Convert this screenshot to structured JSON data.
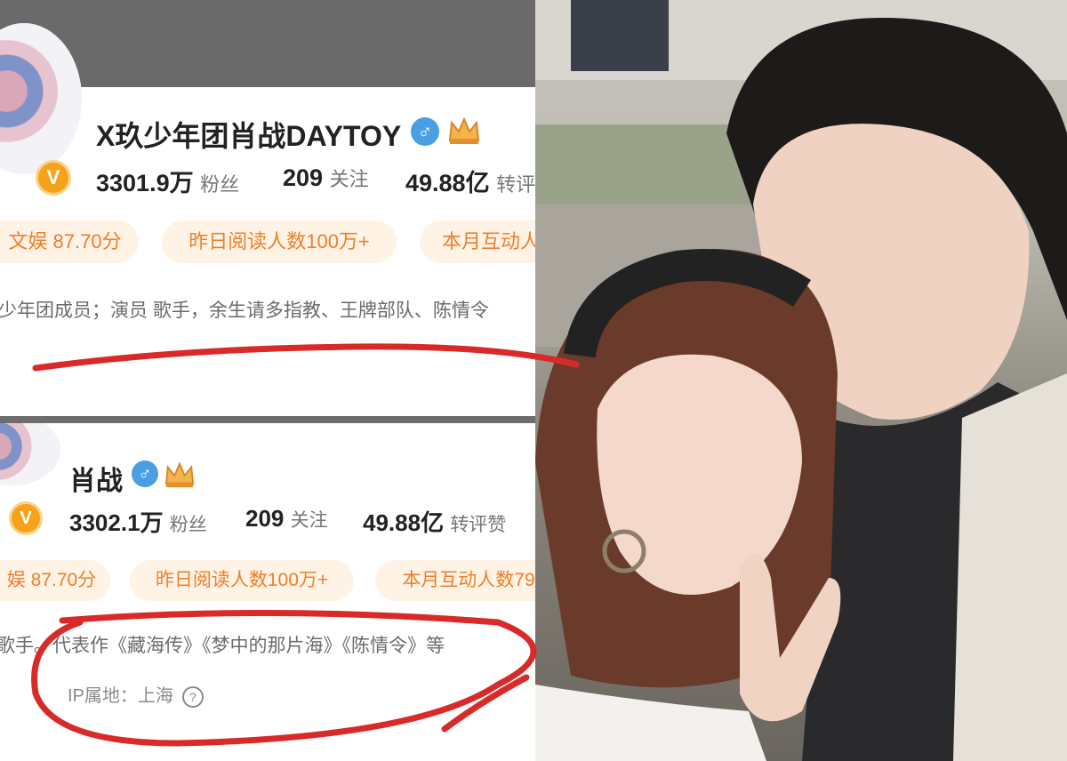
{
  "profile_a": {
    "name": "X玖少年团肖战DAYTOY",
    "gender_symbol": "♂",
    "crown_icon": "crown-icon",
    "verified_badge": "V",
    "followers_value": "3301.9万",
    "followers_label": "粉丝",
    "following_value": "209",
    "following_label": "关注",
    "reposts_value": "49.88亿",
    "reposts_label": "转评",
    "tags": [
      "文娱 87.70分",
      "昨日阅读人数100万+",
      "本月互动人"
    ],
    "bio": "少年团成员；演员 歌手，余生请多指教、王牌部队、陈情令"
  },
  "profile_b": {
    "name": "肖战",
    "gender_symbol": "♂",
    "crown_icon": "crown-icon",
    "verified_badge": "V",
    "followers_value": "3302.1万",
    "followers_label": "粉丝",
    "following_value": "209",
    "following_label": "关注",
    "reposts_value": "49.88亿",
    "reposts_label": "转评赞",
    "tags": [
      "娱 87.70分",
      "昨日阅读人数100万+",
      "本月互动人数79"
    ],
    "bio": "歌手。代表作《藏海传》《梦中的那片海》《陈情令》等",
    "ip_location": "IP属地：上海",
    "help_icon": "?"
  },
  "colors": {
    "annotation_red": "#d92a2a",
    "tag_text": "#f07e2a",
    "tag_background": "#fff3e6",
    "verified_gold": "#f6a21b",
    "gender_blue": "#4a9fe3"
  }
}
